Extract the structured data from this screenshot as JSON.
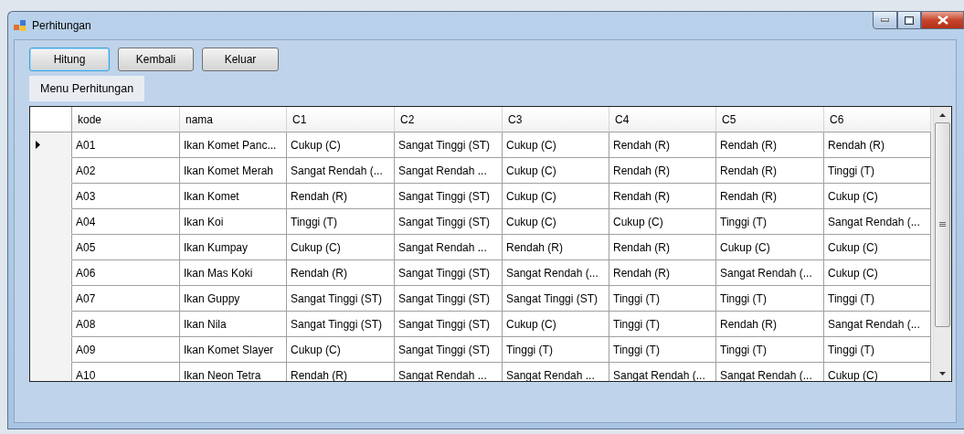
{
  "window": {
    "title": "Perhitungan"
  },
  "buttons": [
    {
      "label": "Hitung",
      "focused": true
    },
    {
      "label": "Kembali",
      "focused": false
    },
    {
      "label": "Keluar",
      "focused": false
    }
  ],
  "section_label": "Menu Perhitungan",
  "table": {
    "columns": [
      "kode",
      "nama",
      "C1",
      "C2",
      "C3",
      "C4",
      "C5",
      "C6"
    ],
    "rows": [
      {
        "selected": true,
        "cells": [
          "A01",
          "Ikan Komet Panc...",
          "Cukup (C)",
          "Sangat Tinggi (ST)",
          "Cukup (C)",
          "Rendah (R)",
          "Rendah (R)",
          "Rendah (R)"
        ]
      },
      {
        "selected": false,
        "cells": [
          "A02",
          "Ikan Komet Merah",
          "Sangat Rendah (...",
          "Sangat Rendah ...",
          "Cukup (C)",
          "Rendah (R)",
          "Rendah (R)",
          "Tinggi (T)"
        ]
      },
      {
        "selected": false,
        "cells": [
          "A03",
          "Ikan Komet",
          "Rendah (R)",
          "Sangat Tinggi (ST)",
          "Cukup (C)",
          "Rendah (R)",
          "Rendah (R)",
          "Cukup (C)"
        ]
      },
      {
        "selected": false,
        "cells": [
          "A04",
          "Ikan Koi",
          "Tinggi (T)",
          "Sangat Tinggi (ST)",
          "Cukup (C)",
          "Cukup (C)",
          "Tinggi (T)",
          "Sangat Rendah (..."
        ]
      },
      {
        "selected": false,
        "cells": [
          "A05",
          "Ikan Kumpay",
          "Cukup (C)",
          "Sangat Rendah ...",
          "Rendah (R)",
          "Rendah (R)",
          "Cukup (C)",
          "Cukup (C)"
        ]
      },
      {
        "selected": false,
        "cells": [
          "A06",
          "Ikan Mas Koki",
          "Rendah (R)",
          "Sangat Tinggi (ST)",
          "Sangat Rendah (...",
          "Rendah (R)",
          "Sangat Rendah (...",
          "Cukup (C)"
        ]
      },
      {
        "selected": false,
        "cells": [
          "A07",
          "Ikan Guppy",
          "Sangat Tinggi (ST)",
          "Sangat Tinggi (ST)",
          "Sangat Tinggi (ST)",
          "Tinggi (T)",
          "Tinggi (T)",
          "Tinggi (T)"
        ]
      },
      {
        "selected": false,
        "cells": [
          "A08",
          "Ikan Nila",
          "Sangat Tinggi (ST)",
          "Sangat Tinggi (ST)",
          "Cukup (C)",
          "Tinggi (T)",
          "Rendah (R)",
          "Sangat Rendah (..."
        ]
      },
      {
        "selected": false,
        "cells": [
          "A09",
          "Ikan Komet Slayer",
          "Cukup (C)",
          "Sangat Tinggi (ST)",
          "Tinggi (T)",
          "Tinggi (T)",
          "Tinggi (T)",
          "Tinggi (T)"
        ]
      },
      {
        "selected": false,
        "cells": [
          "A10",
          "Ikan Neon Tetra",
          "Rendah (R)",
          "Sangat Rendah ...",
          "Sangat Rendah ...",
          "Sangat Rendah (...",
          "Sangat Rendah (...",
          "Cukup (C)"
        ]
      }
    ]
  }
}
